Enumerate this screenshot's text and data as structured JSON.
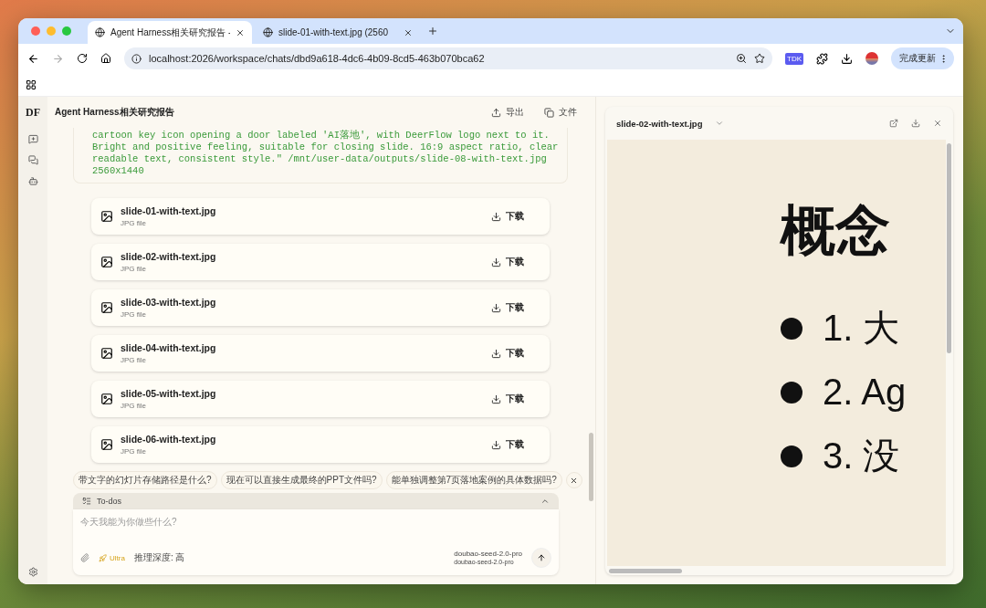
{
  "browser": {
    "tabs": [
      {
        "title": "Agent Harness相关研究报告 -",
        "selected": true
      },
      {
        "title": "slide-01-with-text.jpg (2560",
        "selected": false
      }
    ],
    "url": "localhost:2026/workspace/chats/dbd9a618-4dc6-4b09-8cd5-463b070bca62",
    "extension_badge": "TDK",
    "update_button": "完成更新"
  },
  "sidebar": {
    "logo": "DF"
  },
  "chat": {
    "title": "Agent Harness相关研究报告",
    "actions": [
      "导出",
      "文件"
    ],
    "code_lines": [
      "cartoon key icon opening a door labeled 'AI落地', with DeerFlow logo next to it.",
      "Bright and positive feeling, suitable for closing slide. 16:9 aspect ratio, clear",
      "readable text, consistent style.\" /mnt/user-data/outputs/slide-08-with-text.jpg",
      "2560x1440"
    ],
    "files": [
      {
        "name": "slide-01-with-text.jpg",
        "type": "JPG file",
        "action": "下载"
      },
      {
        "name": "slide-02-with-text.jpg",
        "type": "JPG file",
        "action": "下载"
      },
      {
        "name": "slide-03-with-text.jpg",
        "type": "JPG file",
        "action": "下载"
      },
      {
        "name": "slide-04-with-text.jpg",
        "type": "JPG file",
        "action": "下载"
      },
      {
        "name": "slide-05-with-text.jpg",
        "type": "JPG file",
        "action": "下载"
      },
      {
        "name": "slide-06-with-text.jpg",
        "type": "JPG file",
        "action": "下载"
      }
    ],
    "suggestions": [
      "带文字的幻灯片存储路径是什么?",
      "现在可以直接生成最终的PPT文件吗?",
      "能单独调整第7页落地案例的具体数据吗?"
    ],
    "todos": {
      "label": "To-dos"
    },
    "composer": {
      "placeholder": "今天我能为你做些什么?",
      "mode": "Ultra",
      "reasoning": "推理深度: 高",
      "model": "doubao-seed-2.0-pro",
      "model_detail": "doubao-seed-2.0-pro"
    }
  },
  "preview": {
    "file": "slide-02-with-text.jpg",
    "slide": {
      "title": "概念",
      "bullets": [
        "1. 大",
        "2. Ag",
        "3. 没"
      ]
    }
  }
}
